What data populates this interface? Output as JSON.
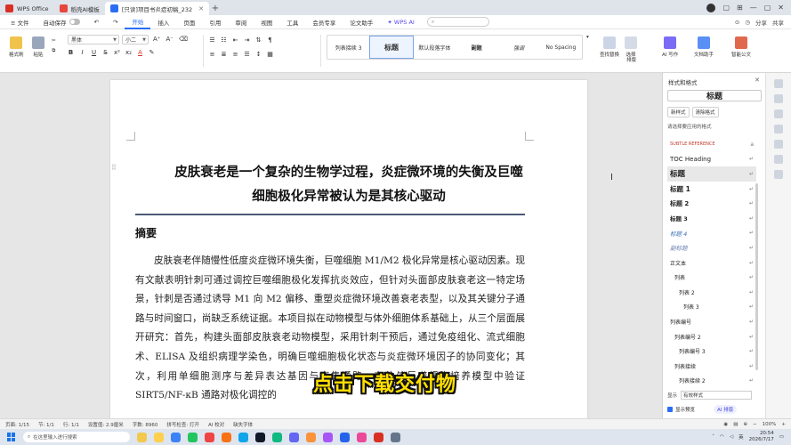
{
  "titlebar": {
    "tabs": [
      {
        "label": "WPS Office",
        "color": "#d93025",
        "active": false
      },
      {
        "label": "稻壳AI模板",
        "color": "#e8453c",
        "active": false
      },
      {
        "label": "[只读]项目书炎症初稿_232",
        "color": "#2a6df4",
        "active": true
      }
    ],
    "add_tab": "+",
    "window_controls": [
      "▢",
      "⊞",
      "—",
      "▢",
      "✕"
    ]
  },
  "menubar": {
    "file": "≡ 文件",
    "autosave": "自动保存",
    "items": [
      "开始",
      "插入",
      "页面",
      "引用",
      "审阅",
      "视图",
      "工具",
      "会员专享",
      "论文助手"
    ],
    "active": "开始",
    "wps_ai": "✦ WPS AI",
    "search_icon": "search-icon",
    "right": [
      "⊙",
      "◷",
      "分享",
      "共享"
    ]
  },
  "ribbon": {
    "format_painter": "格式刷",
    "paste": "粘贴",
    "font_name": "黑体",
    "font_size": "小二",
    "bold": "B",
    "italic": "I",
    "underline": "U",
    "font_color": "A",
    "style_gallery": [
      "列表接续 3",
      "标题",
      "默认段落字体",
      "副题",
      "强调",
      "No Spacing"
    ],
    "style_selected": "标题",
    "find_replace": "查找替换",
    "select": "选择",
    "sort": "排版",
    "wps_ai": "AI 写作",
    "doc_assist": "文档助手",
    "smart_doc": "智能公文"
  },
  "document": {
    "title_line1": "皮肤衰老是一个复杂的生物学过程，炎症微环境的失衡及巨噬",
    "title_line2": "细胞极化异常被认为是其核心驱动",
    "abstract_heading": "摘要",
    "body": "皮肤衰老伴随慢性低度炎症微环境失衡，巨噬细胞 M1/M2 极化异常是核心驱动因素。现有文献表明针刺可通过调控巨噬细胞极化发挥抗炎效应，但针对头面部皮肤衰老这一特定场景，针刺是否通过诱导 M1 向 M2 偏移、重塑炎症微环境改善衰老表型，以及其关键分子通路与时间窗口，尚缺乏系统证据。本项目拟在动物模型与体外细胞体系基础上，从三个层面展开研究：首先，构建头面部皮肤衰老动物模型，采用针刺干预后，通过免疫组化、流式细胞术、ELISA 及组织病理学染色，明确巨噬细胞极化状态与炎症微环境因子的协同变化；其次，利用单细胞测序与差异表达基因与富集通路，在体外巨噬细胞培养模型中验证 SIRT5/NF-κB 通路对极化调控的"
  },
  "overlay_caption": "点击下载交付物",
  "styles_panel": {
    "title": "样式和格式",
    "close": "✕",
    "current_style": "标题",
    "new_style": "新样式",
    "clear_format": "清除格式",
    "subtitle": "请选择要应用的格式",
    "styles": [
      {
        "label": "SUBTLE REFERENCE",
        "color": "#c0392b",
        "size": 5
      },
      {
        "label": "TOC Heading",
        "color": "#222",
        "size": 7
      },
      {
        "label": "标题",
        "color": "#222",
        "size": 8.5
      },
      {
        "label": "标题 1",
        "color": "#222",
        "size": 7.5
      },
      {
        "label": "标题 2",
        "color": "#222",
        "size": 7
      },
      {
        "label": "标题 3",
        "color": "#222",
        "size": 6.5
      },
      {
        "label": "标题 4",
        "color": "#3d6fb6",
        "size": 6.5
      },
      {
        "label": "副标题",
        "color": "#6a7fb0",
        "size": 6.5
      },
      {
        "label": "正文本",
        "color": "#222",
        "size": 6
      },
      {
        "label": "列表",
        "color": "#222",
        "size": 6
      },
      {
        "label": "列表 2",
        "color": "#222",
        "size": 6
      },
      {
        "label": "列表 3",
        "color": "#222",
        "size": 6
      },
      {
        "label": "列表编号",
        "color": "#222",
        "size": 6
      },
      {
        "label": "列表编号 2",
        "color": "#222",
        "size": 6
      },
      {
        "label": "列表编号 3",
        "color": "#222",
        "size": 6
      },
      {
        "label": "列表接续",
        "color": "#222",
        "size": 6
      },
      {
        "label": "列表接续 2",
        "color": "#222",
        "size": 6
      }
    ],
    "selected_index": 2,
    "show_label": "显示",
    "show_value": "有效样式",
    "show_preview": "显示预览",
    "ai_style": "AI 排版"
  },
  "statusbar": {
    "page": "页面: 1/15",
    "section": "节: 1/1",
    "line": "行: 1/1",
    "position": "设置值: 2.9厘米",
    "words": "字数: 8960",
    "spell": "拼写检查: 打开",
    "ai_proof": "AI 校对",
    "missing_font": "缺失字体",
    "zoom": "100%"
  },
  "taskbar": {
    "search_placeholder": "在这里输入进行搜索",
    "time": "20:54",
    "date": "2026/7/17",
    "lang": "英"
  }
}
